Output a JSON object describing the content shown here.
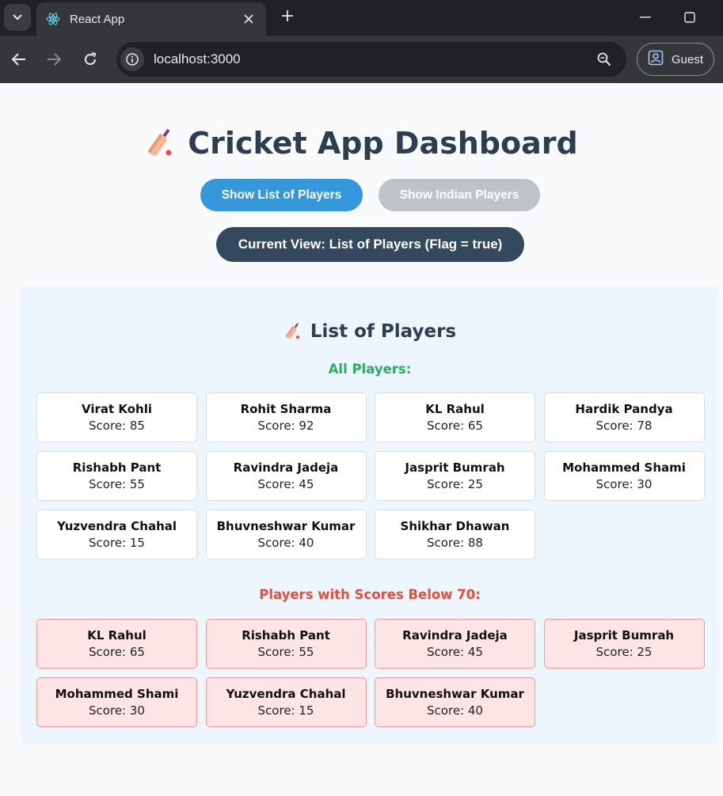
{
  "browser": {
    "tab_title": "React App",
    "url": "localhost:3000",
    "profile_label": "Guest"
  },
  "page": {
    "title": "Cricket App Dashboard",
    "buttons": {
      "show_players": "Show List of Players",
      "show_indian": "Show Indian Players"
    },
    "current_view": "Current View: List of Players (Flag = true)",
    "panel_title": "List of Players",
    "all_players_heading": "All Players:",
    "below_heading": "Players with Scores Below 70:",
    "all_players": [
      {
        "name": "Virat Kohli",
        "score": "Score: 85"
      },
      {
        "name": "Rohit Sharma",
        "score": "Score: 92"
      },
      {
        "name": "KL Rahul",
        "score": "Score: 65"
      },
      {
        "name": "Hardik Pandya",
        "score": "Score: 78"
      },
      {
        "name": "Rishabh Pant",
        "score": "Score: 55"
      },
      {
        "name": "Ravindra Jadeja",
        "score": "Score: 45"
      },
      {
        "name": "Jasprit Bumrah",
        "score": "Score: 25"
      },
      {
        "name": "Mohammed Shami",
        "score": "Score: 30"
      },
      {
        "name": "Yuzvendra Chahal",
        "score": "Score: 15"
      },
      {
        "name": "Bhuvneshwar Kumar",
        "score": "Score: 40"
      },
      {
        "name": "Shikhar Dhawan",
        "score": "Score: 88"
      }
    ],
    "below_players": [
      {
        "name": "KL Rahul",
        "score": "Score: 65"
      },
      {
        "name": "Rishabh Pant",
        "score": "Score: 55"
      },
      {
        "name": "Ravindra Jadeja",
        "score": "Score: 45"
      },
      {
        "name": "Jasprit Bumrah",
        "score": "Score: 25"
      },
      {
        "name": "Mohammed Shami",
        "score": "Score: 30"
      },
      {
        "name": "Yuzvendra Chahal",
        "score": "Score: 15"
      },
      {
        "name": "Bhuvneshwar Kumar",
        "score": "Score: 40"
      }
    ]
  },
  "icons": {
    "tab_favicon": "react-logo-icon",
    "heading": "cricket-bat-icon"
  },
  "colors": {
    "primary_button": "#3498db",
    "disabled_button": "#bdc3c7",
    "current_view_bg": "#34495e",
    "all_heading": "#27ae60",
    "below_heading": "#e74c3c"
  }
}
